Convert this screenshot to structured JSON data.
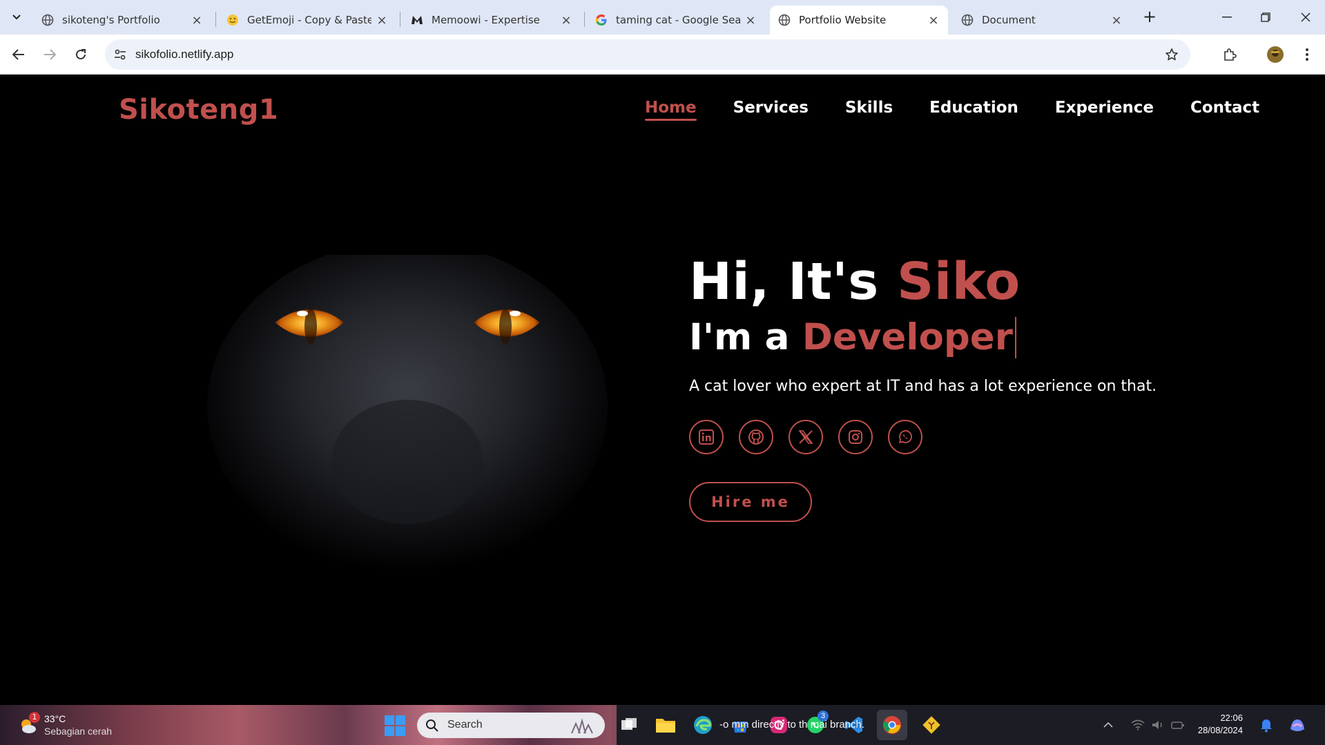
{
  "browser": {
    "tabs": [
      {
        "title": "sikoteng's Portfolio",
        "icon": "globe-icon",
        "active": false
      },
      {
        "title": "GetEmoji - Copy & Paste A",
        "icon": "emoji-icon",
        "active": false
      },
      {
        "title": "Memoowi - Expertise",
        "icon": "memoowi-icon",
        "active": false
      },
      {
        "title": "taming cat - Google Searc",
        "icon": "google-icon",
        "active": false
      },
      {
        "title": "Portfolio Website",
        "icon": "globe-icon",
        "active": true
      },
      {
        "title": "Document",
        "icon": "globe-icon",
        "active": false
      }
    ],
    "url": "sikofolio.netlify.app"
  },
  "site": {
    "logo": "Sikoteng1",
    "nav": [
      "Home",
      "Services",
      "Skills",
      "Education",
      "Experience",
      "Contact"
    ],
    "active_nav": "Home",
    "greeting_prefix": "Hi, It's ",
    "greeting_name": "Siko",
    "role_prefix": "I'm a ",
    "role": "Developer",
    "tagline": "A cat lover who expert at IT and has a lot experience on that.",
    "socials": [
      "linkedin-icon",
      "github-icon",
      "x-icon",
      "instagram-icon",
      "whatsapp-icon"
    ],
    "hire_label": "Hire me",
    "accent_color": "#c0504d"
  },
  "taskbar": {
    "weather_badge": "1",
    "temperature": "33°C",
    "condition": "Sebagian cerah",
    "search_placeholder": "Search",
    "app_badge": "3",
    "overlay_text": "-o mm directly to th mai branch.",
    "time": "22:06",
    "date": "28/08/2024"
  }
}
